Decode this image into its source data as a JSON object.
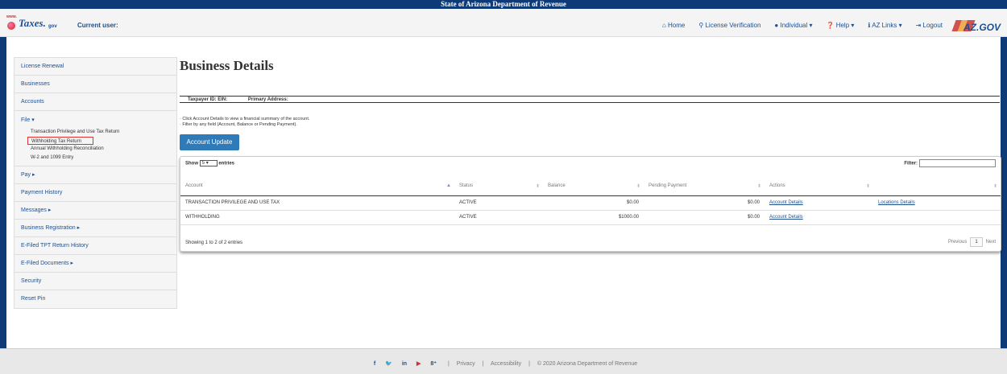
{
  "header": {
    "title": "State of Arizona Department of Revenue",
    "logo": {
      "www": "www.",
      "text": "Taxes.",
      "suffix": "gov"
    },
    "current_user_label": "Current user:",
    "nav": [
      {
        "icon": "home-icon",
        "label": "Home"
      },
      {
        "icon": "search-icon",
        "label": "License Verification"
      },
      {
        "icon": "user-icon",
        "label": "Individual ▾"
      },
      {
        "icon": "help-icon",
        "label": "Help ▾"
      },
      {
        "icon": "info-icon",
        "label": "AZ Links ▾"
      },
      {
        "icon": "logout-icon",
        "label": "Logout"
      }
    ],
    "azgov": "AZ.GOV"
  },
  "sidebar": {
    "items_top": [
      "License Renewal",
      "Businesses",
      "Accounts"
    ],
    "file": {
      "label": "File ▾",
      "subitems": [
        "Transaction Privilege and Use Tax Return",
        "Withholding Tax Return",
        "Annual Withholding Reconciliation",
        "W-2 and 1099 Entry"
      ]
    },
    "items_bottom": [
      "Pay ▸",
      "Payment History",
      "Messages ▸",
      "Business Registration ▸",
      "E-Filed TPT Return History",
      "E-Filed Documents ▸",
      "Security",
      "Reset Pin"
    ]
  },
  "main": {
    "title": "Business Details",
    "taxpayer_label": "Taxpayer ID: EIN:",
    "address_label": "Primary Address:",
    "notes": [
      "· Click Account Details to view a financial summary of the account.",
      "· Filter by any field (Account, Balance or Pending Payment)."
    ],
    "update_button": "Account Update"
  },
  "table": {
    "show_label": "Show",
    "show_value": "5",
    "entries_label": "entries",
    "filter_label": "Filter:",
    "columns": [
      "Account",
      "Status",
      "Balance",
      "Pending Payment",
      "Actions",
      ""
    ],
    "rows": [
      {
        "account": "TRANSACTION PRIVILEGE AND USE TAX",
        "status": "ACTIVE",
        "balance": "$0.00",
        "pending": "$0.00",
        "action1": "Account Details",
        "action2": "Locations Details"
      },
      {
        "account": "WITHHOLDING",
        "status": "ACTIVE",
        "balance": "$1000.00",
        "pending": "$0.00",
        "action1": "Account Details",
        "action2": ""
      }
    ],
    "info": "Showing 1 to 2 of 2 entries",
    "prev": "Previous",
    "page": "1",
    "next": "Next"
  },
  "footer": {
    "social": [
      "f",
      "t",
      "in",
      "yt",
      "g+"
    ],
    "privacy": "Privacy",
    "accessibility": "Accessibility",
    "copyright": "© 2020 Arizona Department of Revenue"
  },
  "colors": {
    "brand": "#0e3b78",
    "link": "#1d4f91",
    "button": "#2f7ab8",
    "highlight": "#dd3333"
  }
}
